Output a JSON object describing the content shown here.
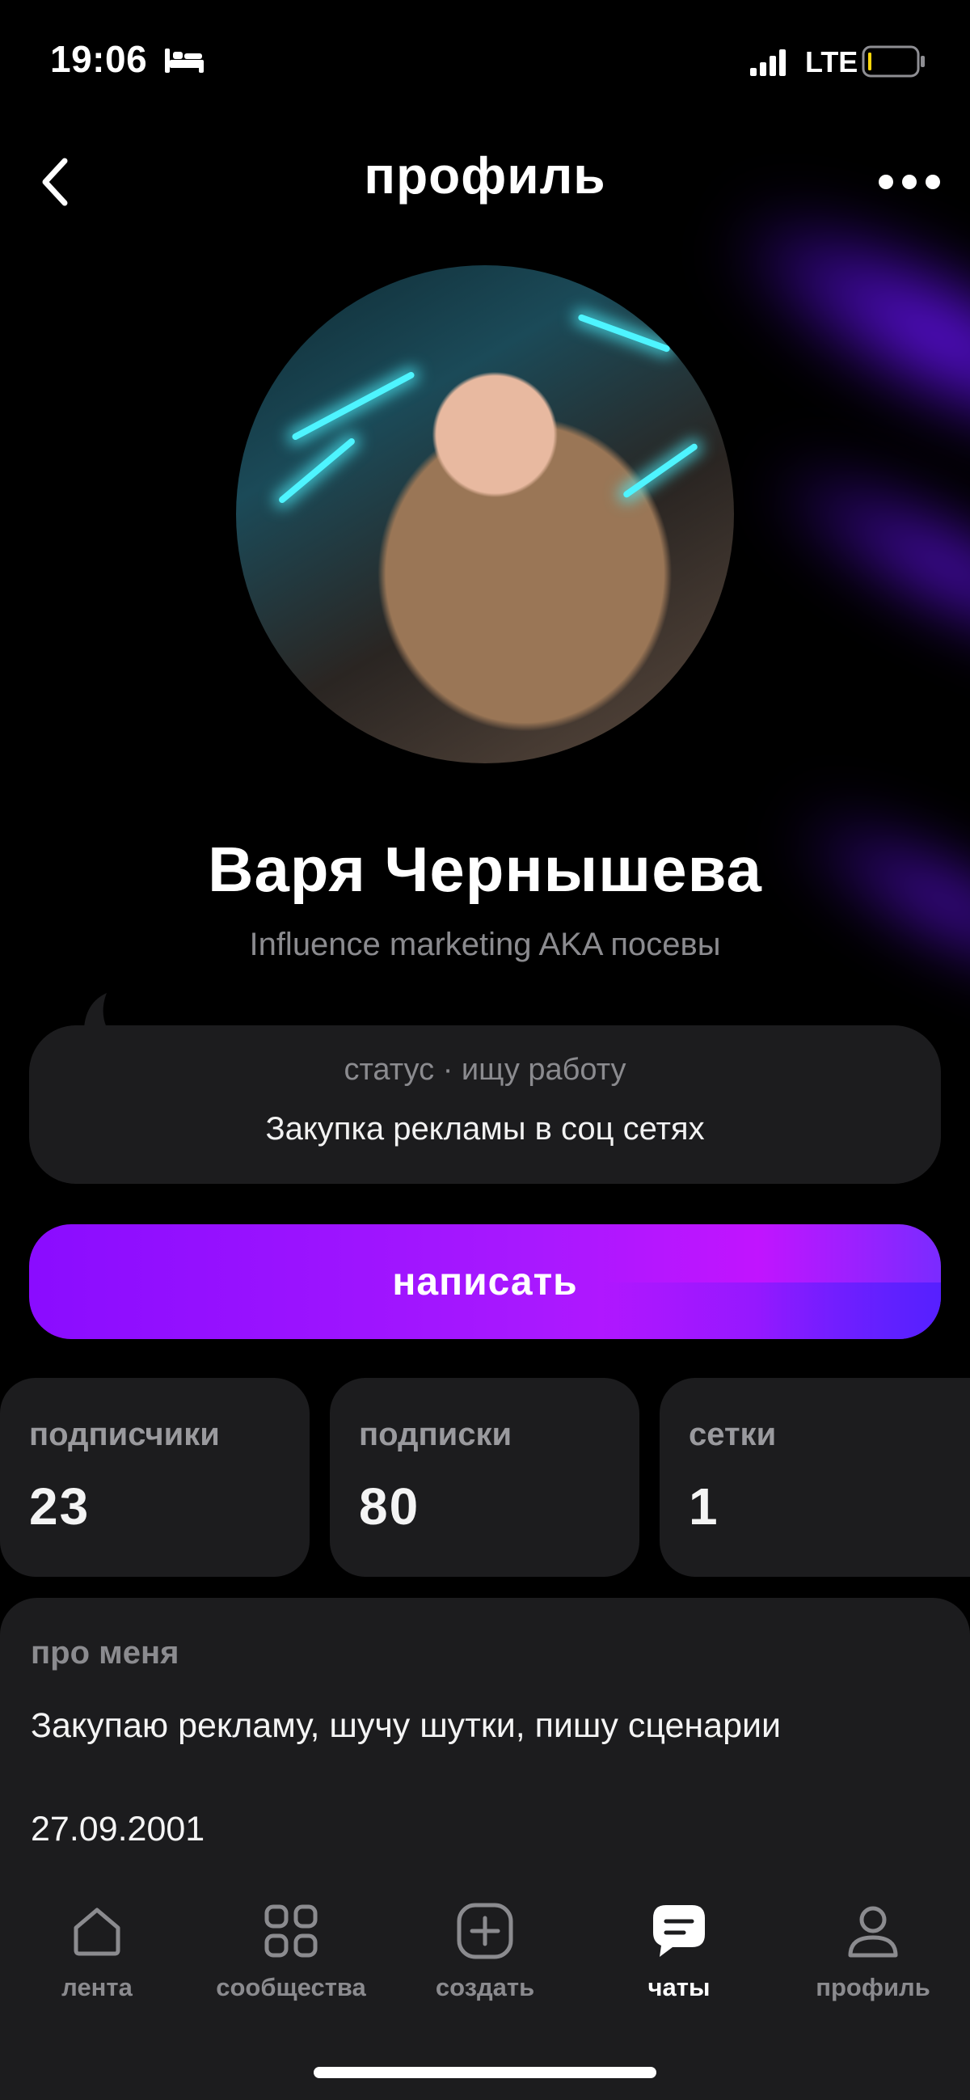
{
  "status_bar": {
    "time": "19:06",
    "network": "LTE",
    "icons": [
      "bed-icon",
      "signal-icon",
      "battery-icon"
    ]
  },
  "header": {
    "title": "профиль",
    "back_icon": "chevron-left-icon",
    "more_icon": "more-dots-icon"
  },
  "profile": {
    "name": "Варя Чернышева",
    "tagline": "Influence marketing AKA посевы",
    "status_label": "статус · ищу работу",
    "status_text": "Закупка рекламы в соц сетях"
  },
  "actions": {
    "write_label": "написать"
  },
  "stats": [
    {
      "label": "подписчики",
      "value": "23"
    },
    {
      "label": "подписки",
      "value": "80"
    },
    {
      "label": "сетки",
      "value": "1"
    }
  ],
  "about": {
    "label": "про меня",
    "text": "Закупаю рекламу, шучу шутки, пишу сценарии",
    "birthday": "27.09.2001"
  },
  "tabs": [
    {
      "label": "лента",
      "icon": "home-icon",
      "active": false
    },
    {
      "label": "сообщества",
      "icon": "grid-icon",
      "active": false
    },
    {
      "label": "создать",
      "icon": "plus-square-icon",
      "active": false
    },
    {
      "label": "чаты",
      "icon": "chat-icon",
      "active": true
    },
    {
      "label": "профиль",
      "icon": "person-icon",
      "active": false
    }
  ],
  "colors": {
    "accent_start": "#8a0cff",
    "accent_end": "#c114ff",
    "glow": "#6e14ff",
    "card": "#1c1c1e",
    "muted_text": "#8b8b8f"
  }
}
